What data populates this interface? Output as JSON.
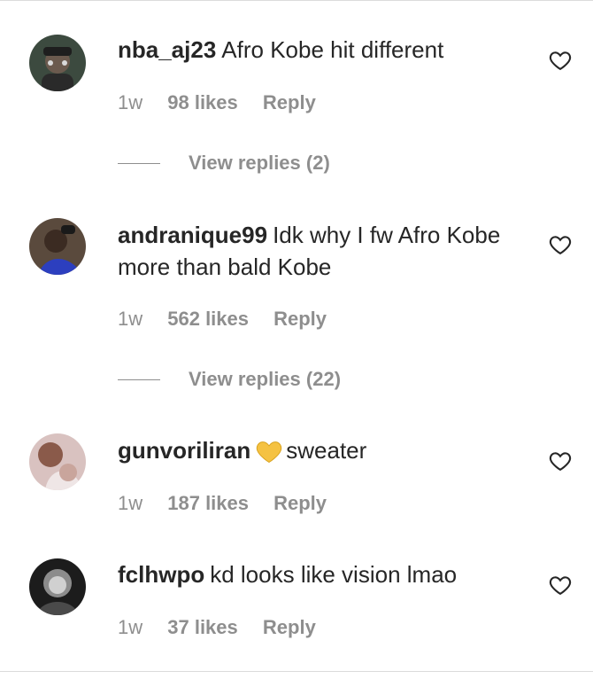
{
  "comments": [
    {
      "username": "nba_aj23",
      "text": "Afro Kobe hit different",
      "time": "1w",
      "likes": "98 likes",
      "reply": "Reply",
      "replies": "View replies (2)",
      "avatar": "avatar-dark-hat"
    },
    {
      "username": "andranique99",
      "text": "Idk why I fw Afro Kobe more than bald Kobe",
      "time": "1w",
      "likes": "562 likes",
      "reply": "Reply",
      "replies": "View replies (22)",
      "avatar": "avatar-blue-top"
    },
    {
      "username": "gunvoriliran",
      "text": "sweater",
      "emoji": "yellow-heart-icon",
      "time": "1w",
      "likes": "187 likes",
      "reply": "Reply",
      "avatar": "avatar-light-skin"
    },
    {
      "username": "fclhwpo",
      "text": "kd looks like vision lmao",
      "time": "1w",
      "likes": "37 likes",
      "reply": "Reply",
      "avatar": "avatar-black-white"
    }
  ],
  "colors": {
    "text": "#262626",
    "muted": "#8e8e8e",
    "divider": "#dbdbdb",
    "emoji_heart": "#f5c242"
  }
}
